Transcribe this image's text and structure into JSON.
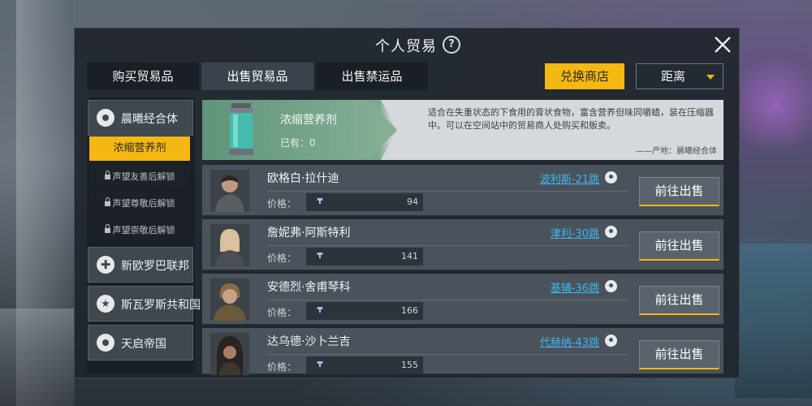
{
  "header": {
    "title": "个人贸易",
    "help_icon": "help-icon",
    "close_icon": "close-icon"
  },
  "tabs": [
    {
      "label": "购买贸易品",
      "active": false
    },
    {
      "label": "出售贸易品",
      "active": true
    },
    {
      "label": "出售禁运品",
      "active": false
    }
  ],
  "toolbar": {
    "exchange_label": "兑换商店",
    "sort_selected": "距离"
  },
  "sidebar": {
    "factions": [
      {
        "label": "晨曦经合体",
        "icon": "planet-emblem-icon"
      },
      {
        "label": "新欧罗巴联邦",
        "icon": "cross-emblem-icon"
      },
      {
        "label": "斯瓦罗斯共和国",
        "icon": "star-emblem-icon"
      },
      {
        "label": "天启帝国",
        "icon": "eagle-emblem-icon"
      }
    ],
    "goods": [
      {
        "label": "浓缩营养剂",
        "locked": false
      },
      {
        "label": "声望友善后解锁",
        "locked": true
      },
      {
        "label": "声望尊敬后解锁",
        "locked": true
      },
      {
        "label": "声望崇敬后解锁",
        "locked": true
      }
    ]
  },
  "item": {
    "name": "浓缩营养剂",
    "owned": "已有：0",
    "description": "适合在失重状态的下食用的膏状食物，富含营养但味同嚼蜡，装在压缩器中。可以在空间站中的贸易商人处购买和贩卖。",
    "origin": "——产地：晨曦经合体"
  },
  "merchants": [
    {
      "name": "欧格白·拉什迪",
      "location": "波利斯-21跳",
      "price_label": "价格：",
      "price": "94",
      "sell_label": "前往出售"
    },
    {
      "name": "詹妮弗·阿斯特利",
      "location": "津利-30跳",
      "price_label": "价格：",
      "price": "141",
      "sell_label": "前往出售"
    },
    {
      "name": "安德烈·舍甫琴科",
      "location": "基辅-36跳",
      "price_label": "价格：",
      "price": "166",
      "sell_label": "前往出售"
    },
    {
      "name": "达乌德·沙卜兰吉",
      "location": "代赫纳-43跳",
      "price_label": "价格：",
      "price": "155",
      "sell_label": "前往出售"
    }
  ],
  "colors": {
    "accent": "#f4b812",
    "link": "#3fb5f0",
    "banner_green": "#6b9b80"
  }
}
